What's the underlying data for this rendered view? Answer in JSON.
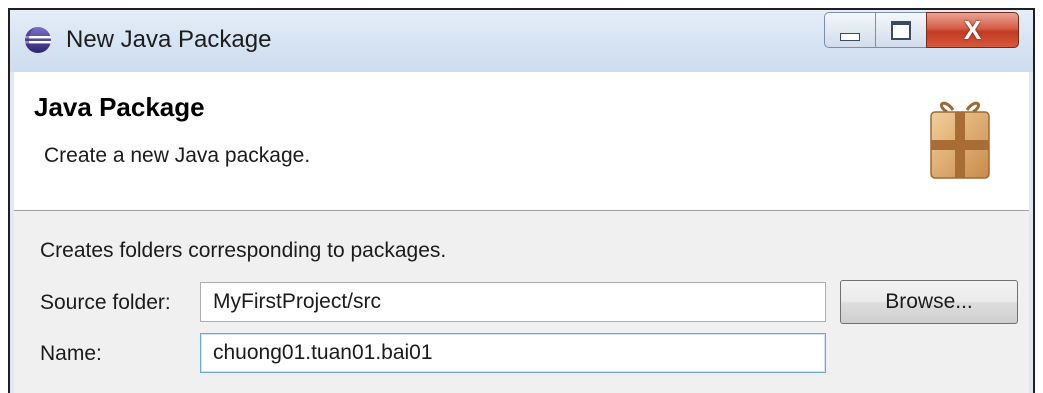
{
  "window": {
    "title": "New Java Package",
    "app_icon": "eclipse-icon",
    "controls": {
      "minimize_icon": "minimize-icon",
      "maximize_icon": "maximize-icon",
      "close_label": "X"
    }
  },
  "header": {
    "title": "Java Package",
    "description": "Create a new Java package.",
    "icon": "package-icon"
  },
  "body": {
    "caption": "Creates folders corresponding to packages.",
    "source_folder": {
      "label": "Source folder:",
      "value": "MyFirstProject/src",
      "browse_label": "Browse..."
    },
    "name": {
      "label": "Name:",
      "value": "chuong01.tuan01.bai01"
    }
  },
  "colors": {
    "titlebar": "#d6e3f2",
    "close_button": "#c23a22",
    "body_background": "#f0f0f0",
    "focus_border": "#6ea8d8"
  }
}
